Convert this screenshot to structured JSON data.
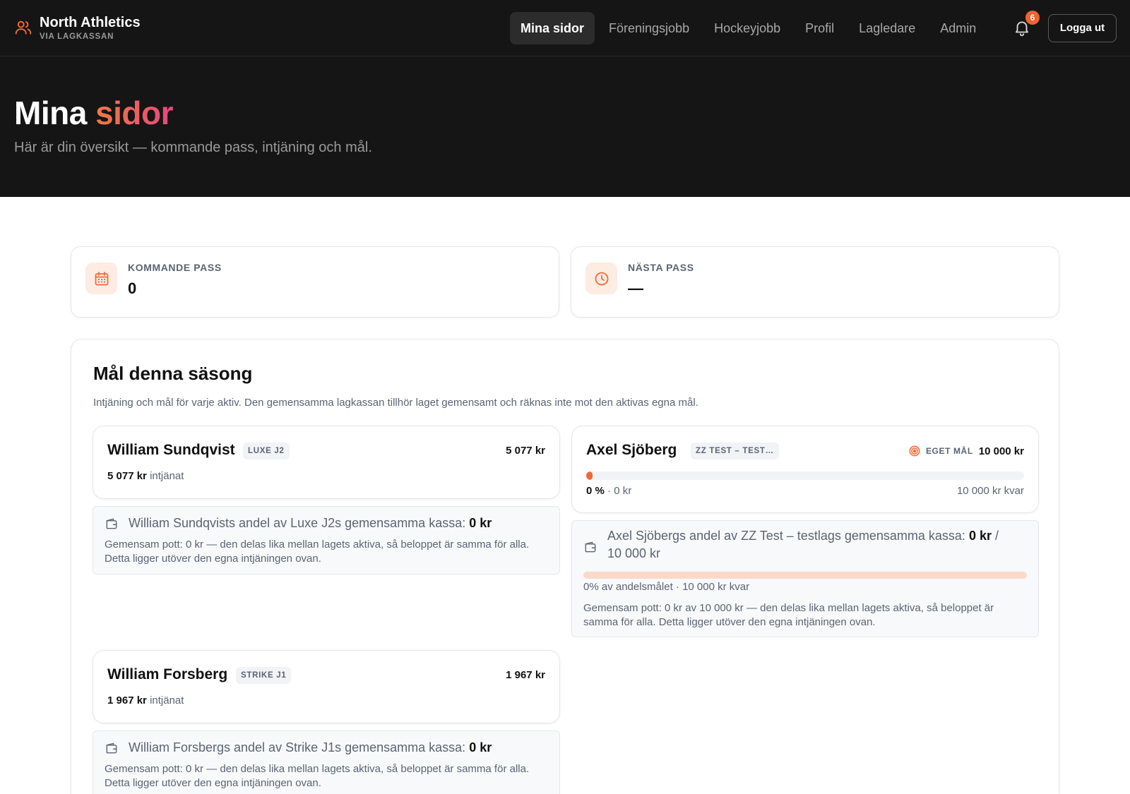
{
  "brand": {
    "name": "North Athletics",
    "sub": "VIA LAGKASSAN"
  },
  "nav": {
    "items": [
      {
        "label": "Mina sidor",
        "active": true
      },
      {
        "label": "Föreningsjobb",
        "active": false
      },
      {
        "label": "Hockeyjobb",
        "active": false
      },
      {
        "label": "Profil",
        "active": false
      },
      {
        "label": "Lagledare",
        "active": false
      },
      {
        "label": "Admin",
        "active": false
      }
    ],
    "notification_count": "6",
    "logout_label": "Logga ut"
  },
  "hero": {
    "title_part1": "Mina",
    "title_part2": "sidor",
    "subtitle": "Här är din översikt — kommande pass, intjäning och mål."
  },
  "stats": {
    "upcoming": {
      "label": "KOMMANDE PASS",
      "value": "0"
    },
    "next": {
      "label": "NÄSTA PASS",
      "value": "—"
    }
  },
  "goals": {
    "title": "Mål denna säsong",
    "description": "Intjäning och mål för varje aktiv. Den gemensamma lagkassan tillhör laget gemensamt och räknas inte mot den aktivas egna mål.",
    "athletes": [
      {
        "name": "William Sundqvist",
        "team": "LUXE J2",
        "amount": "5 077 kr",
        "earned_amount": "5 077 kr",
        "earned_label": "intjänat",
        "pot_title_prefix": "William Sundqvists andel av Luxe J2s gemensamma kassa:",
        "pot_value": "0 kr",
        "pot_note": "Gemensam pott: 0 kr — den delas lika mellan lagets aktiva, så beloppet är samma för alla. Detta ligger utöver den egna intjäningen ovan."
      },
      {
        "name": "Axel Sjöberg",
        "team": "ZZ TEST – TEST…",
        "goal_label": "EGET MÅL",
        "goal_value": "10 000 kr",
        "progress_percent": 0,
        "progress_pct_label": "0 %",
        "progress_earned": "· 0 kr",
        "progress_remaining": "10 000 kr kvar",
        "pot_title_prefix": "Axel Sjöbergs andel av ZZ Test – testlags gemensamma kassa:",
        "pot_value": "0 kr",
        "pot_value_suffix": "/ 10 000 kr",
        "pot_progress_percent": 0,
        "pot_pct_label": "0% av andelsmålet · 10 000 kr kvar",
        "pot_note": "Gemensam pott: 0 kr av 10 000 kr — den delas lika mellan lagets aktiva, så beloppet är samma för alla. Detta ligger utöver den egna intjäningen ovan."
      },
      {
        "name": "William Forsberg",
        "team": "STRIKE J1",
        "amount": "1 967 kr",
        "earned_amount": "1 967 kr",
        "earned_label": "intjänat",
        "pot_title_prefix": "William Forsbergs andel av Strike J1s gemensamma kassa:",
        "pot_value": "0 kr",
        "pot_note": "Gemensam pott: 0 kr — den delas lika mellan lagets aktiva, så beloppet är samma för alla. Detta ligger utöver den egna intjäningen ovan."
      }
    ]
  },
  "colors": {
    "accent": "#ef6a35",
    "accent_gradient_end": "#e4487e",
    "header_bg": "#151515",
    "badge": "#f0632f"
  }
}
